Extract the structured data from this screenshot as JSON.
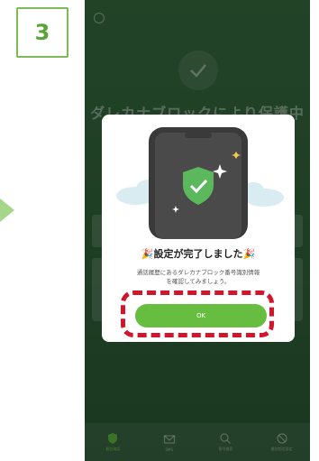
{
  "step_badge": "3",
  "background": {
    "title": "ダレカナブロックにより保護中"
  },
  "modal": {
    "title": "設定が完了しました",
    "message_line1": "通話履歴にあるダレカナブロック番号識別情報",
    "message_line2": "を確認してみましょう。",
    "ok_label": "OK"
  },
  "tabbar": {
    "items": [
      {
        "label": "着信確認",
        "icon": "shield-icon"
      },
      {
        "label": "SMS",
        "icon": "mail-icon"
      },
      {
        "label": "番号検索",
        "icon": "search-icon"
      },
      {
        "label": "着信拒否設定",
        "icon": "block-icon"
      }
    ]
  },
  "colors": {
    "accent_green": "#66bd3f",
    "highlight_red": "#d0152c",
    "phone_bg": "#2f5a35"
  }
}
